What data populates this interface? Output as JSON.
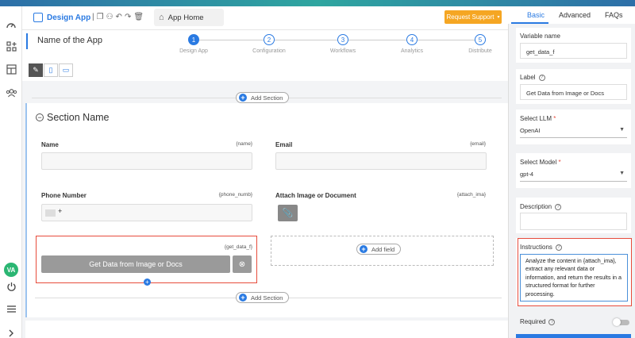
{
  "header": {
    "app_label": "Design App",
    "home_tab": "App Home",
    "request_support": "Request Support"
  },
  "stepper": {
    "app_name": "Name of the App",
    "steps": [
      {
        "num": "1",
        "label": "Design App"
      },
      {
        "num": "2",
        "label": "Configuration"
      },
      {
        "num": "3",
        "label": "Workflows"
      },
      {
        "num": "4",
        "label": "Analytics"
      },
      {
        "num": "5",
        "label": "Distribute"
      }
    ]
  },
  "canvas": {
    "add_section": "Add Section",
    "section_name": "Section Name",
    "fields": {
      "name": {
        "label": "Name",
        "tag": "{name}"
      },
      "email": {
        "label": "Email",
        "tag": "{email}"
      },
      "phone": {
        "label": "Phone Number",
        "tag": "{phone_numb}",
        "prefix": "+"
      },
      "attach": {
        "label": "Attach Image or Document",
        "tag": "{attach_ima}"
      },
      "get_data": {
        "label": "Get Data from Image or Docs",
        "tag": "{get_data_f}"
      }
    },
    "add_field": "Add field"
  },
  "user": {
    "initials": "VA"
  },
  "panel": {
    "tabs": [
      "Basic",
      "Advanced",
      "FAQs"
    ],
    "variable_name_label": "Variable name",
    "variable_name_value": "get_data_f",
    "label_label": "Label",
    "label_value": "Get Data from Image or Docs",
    "select_llm_label": "Select LLM",
    "select_llm_value": "OpenAI",
    "select_model_label": "Select Model",
    "select_model_value": "gpt-4",
    "description_label": "Description",
    "instructions_label": "Instructions",
    "instructions_value": "Analyze the content in {attach_ima}, extract any relevant data or information, and return the results in a structured format for further processing.",
    "required_label": "Required",
    "required_star": "*"
  },
  "colors": {
    "accent": "#2a7ae2",
    "highlight": "#e74c3c",
    "support": "#f5a623",
    "avatar": "#2bb673"
  }
}
